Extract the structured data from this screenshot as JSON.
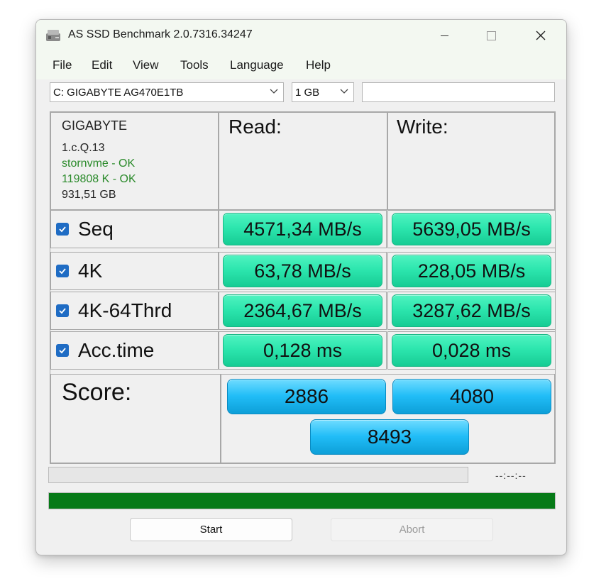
{
  "window": {
    "title": "AS SSD Benchmark 2.0.7316.34247"
  },
  "menu": [
    "File",
    "Edit",
    "View",
    "Tools",
    "Language",
    "Help"
  ],
  "drive_select": {
    "value": "C: GIGABYTE AG470E1TB"
  },
  "size_select": {
    "value": "1 GB"
  },
  "extra_field": {
    "value": ""
  },
  "drive_info": {
    "brand": "GIGABYTE",
    "firmware": "1.c.Q.13",
    "driver_status": "stornvme - OK",
    "alignment_status": "119808 K - OK",
    "capacity": "931,51 GB"
  },
  "columns": {
    "read": "Read:",
    "write": "Write:"
  },
  "tests": [
    {
      "label": "Seq",
      "checked": true,
      "read": "4571,34 MB/s",
      "write": "5639,05 MB/s"
    },
    {
      "label": "4K",
      "checked": true,
      "read": "63,78 MB/s",
      "write": "228,05 MB/s"
    },
    {
      "label": "4K-64Thrd",
      "checked": true,
      "read": "2364,67 MB/s",
      "write": "3287,62 MB/s"
    },
    {
      "label": "Acc.time",
      "checked": true,
      "read": "0,128 ms",
      "write": "0,028 ms"
    }
  ],
  "score": {
    "label": "Score:",
    "read": "2886",
    "write": "4080",
    "total": "8493"
  },
  "status": {
    "time": "--:--:--",
    "test_progress": 0,
    "overall_progress": 1.0
  },
  "buttons": {
    "start": "Start",
    "abort": "Abort"
  },
  "colors": {
    "result_pill": "#2de6ae",
    "score_pill": "#21bdf7",
    "progress_fill": "#067a17",
    "ok_text": "#2a8a2a",
    "checkbox": "#1f6cc4"
  }
}
